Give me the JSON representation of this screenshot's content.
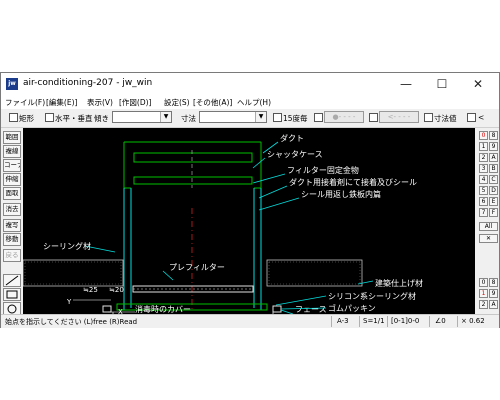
{
  "window": {
    "app_icon_text": "jw",
    "title": "air-conditioning-207 - jw_win",
    "minimize": "—",
    "maximize": "☐",
    "close": "✕"
  },
  "menu": [
    "ファイル(F)",
    "[編集(E)]",
    "表示(V)",
    "[作図(D)]",
    "設定(S)",
    "[その他(A)]",
    "ヘルプ(H)"
  ],
  "toolbar": {
    "rect_label": "矩形",
    "hv_label": "水平・垂直",
    "slope_label": "傾き",
    "dim_label": "寸法",
    "deg15_label": "15度毎",
    "btn1_label": "●- - - -",
    "btn2_label": "<- - - -",
    "dimval_label": "寸法値",
    "lt_label": "<"
  },
  "left_tools": [
    "範囲",
    "複線",
    "コーナー",
    "伸縮",
    "面取",
    "消去",
    "複写",
    "移動",
    "戻る"
  ],
  "right_tools": [
    "0",
    "8",
    "1",
    "9",
    "2",
    "A",
    "3",
    "B",
    "4",
    "C",
    "5",
    "D",
    "6",
    "E",
    "7",
    "F"
  ],
  "right_tools_extra": {
    "all": "All",
    "x": "✕",
    "bottom": [
      "0",
      "8",
      "1",
      "9",
      "2",
      "A"
    ]
  },
  "drawing": {
    "labels": {
      "duct": "ダクト",
      "shutter_case": "シャッタケース",
      "filter_fix": "フィルター固定金物",
      "duct_adhesive": "ダクト用接着剤にて接着及びシール",
      "seal_flange": "シール用返し鉄板内篇",
      "sealing_left": "シーリング材",
      "prefilter": "プレフィルター",
      "building_finish": "建築仕上げ材",
      "silicone": "シリコン系シーリング材",
      "rubber": "ゴムパッキン",
      "face": "フェース",
      "disinfect_cover": "消毒時のカバー",
      "dim25": "≒25",
      "dim20": "≒20",
      "x": "X",
      "y": "Y"
    }
  },
  "status": {
    "message": "始点を指示してください (L)free (R)Read",
    "paper": "A-3",
    "scale": "S=1/1",
    "layer": "[0-1]0-0",
    "angle": "∠0",
    "zoom": "× 0.62"
  }
}
